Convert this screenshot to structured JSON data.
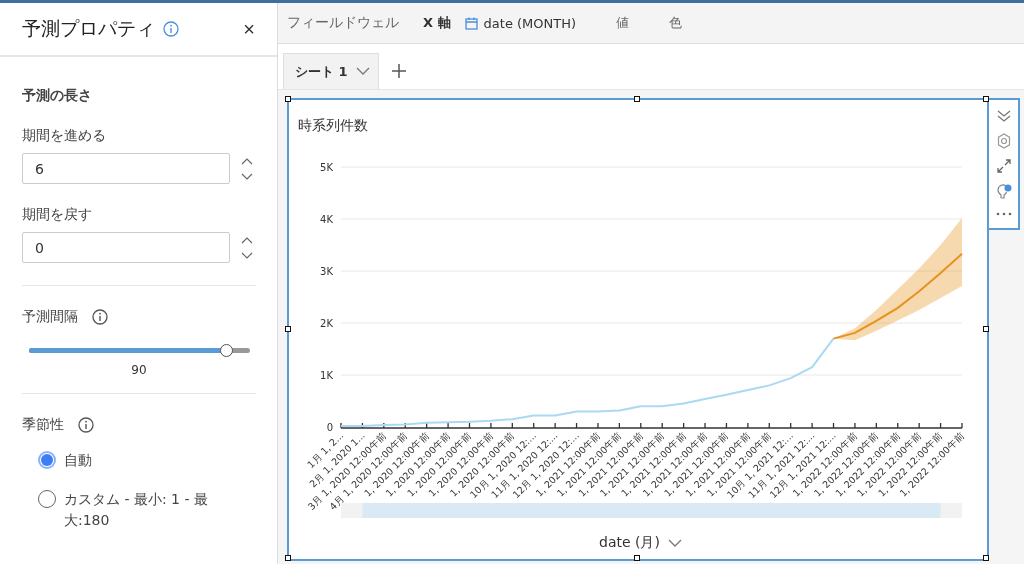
{
  "panel": {
    "title": "予測プロパティ",
    "close": "×",
    "length": {
      "heading": "予測の長さ",
      "fields": [
        {
          "label": "期間を進める",
          "value": "6"
        },
        {
          "label": "期間を戻す",
          "value": "0"
        }
      ]
    },
    "interval": {
      "label": "予測間隔",
      "level": 0.89,
      "reading": "90"
    },
    "seasonality": {
      "label": "季節性",
      "options": [
        {
          "label": "自動",
          "selected": true
        },
        {
          "label": "カスタム - 最小: 1 - 最大:180",
          "selected": false
        }
      ]
    }
  },
  "field_wells": {
    "label": "フィールドウェル",
    "wells": [
      {
        "label": "X 軸",
        "field": "date (MONTH)"
      },
      {
        "label": "値"
      },
      {
        "label": "色"
      }
    ]
  },
  "sheet_tabs": [
    {
      "label": "シート 1",
      "selected": true
    }
  ],
  "visual": {
    "title": "時系列件数",
    "x_field": "date (月)",
    "chart_data": {
      "type": "line",
      "grid": true,
      "ylim": [
        0,
        5000
      ],
      "yticks": [
        {
          "value": 0,
          "label": "0"
        },
        {
          "value": 1000,
          "label": "1K"
        },
        {
          "value": 2000,
          "label": "2K"
        },
        {
          "value": 3000,
          "label": "3K"
        },
        {
          "value": 4000,
          "label": "4K"
        },
        {
          "value": 5000,
          "label": "5K"
        }
      ],
      "categories": [
        "1月 1, 2...",
        "2月 1, 2020 1...",
        "3月 1, 2020 12:00午前",
        "4月 1, 2020 12:00午前",
        "1, 2020 12:00午前",
        "1, 2020 12:00午前",
        "1, 2020 12:00午前",
        "1, 2020 12:00午前",
        "1, 2020 12:00午前",
        "10月 1, 2020 12:...",
        "11月 1, 2020 12:...",
        "12月 1, 2020 12:...",
        "1, 2021 12:00午前",
        "1, 2021 12:00午前",
        "1, 2021 12:00午前",
        "1, 2021 12:00午前",
        "1, 2021 12:00午前",
        "1, 2021 12:00午前",
        "1, 2021 12:00午前",
        "1, 2021 12:00午前",
        "1, 2021 12:00午前",
        "10月 1, 2021 12:...",
        "11月 1, 2021 12:...",
        "12月 1, 2021 12:...",
        "1, 2022 12:00午前",
        "1, 2022 12:00午前",
        "1, 2022 12:00午前",
        "1, 2022 12:00午前",
        "1, 2022 12:00午前",
        "1, 2022 12:00午前"
      ],
      "series": [
        {
          "color": "#a9daf2",
          "values": [
            20,
            20,
            40,
            50,
            80,
            90,
            100,
            120,
            150,
            220,
            220,
            300,
            300,
            320,
            400,
            400,
            450,
            540,
            620,
            710,
            800,
            940,
            1150,
            1700,
            null,
            null,
            null,
            null,
            null,
            null
          ]
        },
        {
          "color": "#e8921e",
          "values": [
            null,
            null,
            null,
            null,
            null,
            null,
            null,
            null,
            null,
            null,
            null,
            null,
            null,
            null,
            null,
            null,
            null,
            null,
            null,
            null,
            null,
            null,
            null,
            1700,
            1810,
            2040,
            2290,
            2610,
            2960,
            3330
          ],
          "lower": [
            null,
            null,
            null,
            null,
            null,
            null,
            null,
            null,
            null,
            null,
            null,
            null,
            null,
            null,
            null,
            null,
            null,
            null,
            null,
            null,
            null,
            null,
            null,
            1700,
            1670,
            1850,
            2050,
            2250,
            2480,
            2710
          ],
          "upper": [
            null,
            null,
            null,
            null,
            null,
            null,
            null,
            null,
            null,
            null,
            null,
            null,
            null,
            null,
            null,
            null,
            null,
            null,
            null,
            null,
            null,
            null,
            null,
            1700,
            1900,
            2250,
            2650,
            3050,
            3500,
            4020
          ]
        }
      ]
    }
  }
}
